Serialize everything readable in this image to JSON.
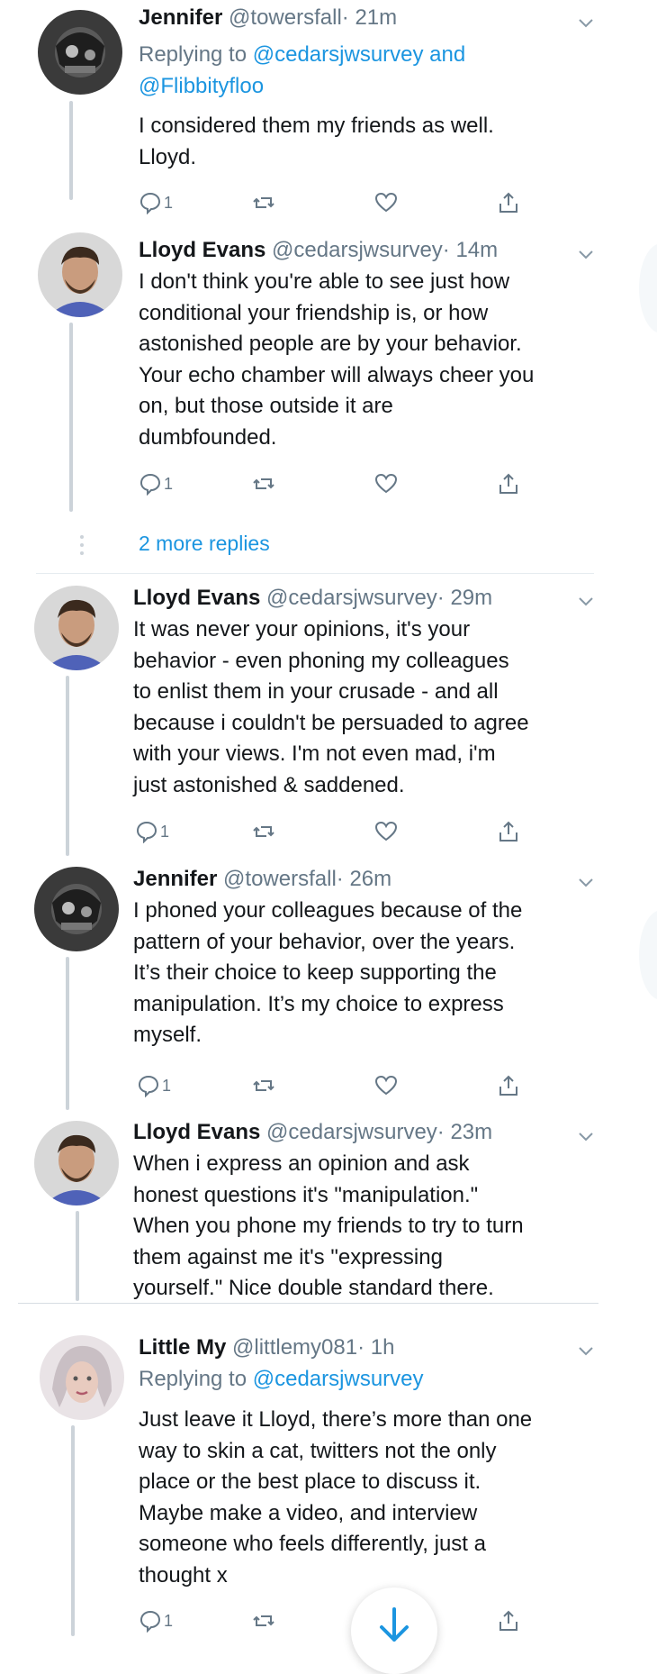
{
  "tweets": [
    {
      "name": "Jennifer",
      "handle": "@towersfall",
      "time": "· 21m",
      "replying_prefix": "Replying to",
      "replying_mention1": "@cedarsjwsurvey",
      "replying_and": "and",
      "replying_mention2": "@Flibbityfloo",
      "lines": [
        "I considered them my friends as well.",
        "Lloyd."
      ],
      "reply_count": "1"
    },
    {
      "name": "Lloyd Evans",
      "handle": "@cedarsjwsurvey",
      "time": "· 14m",
      "lines": [
        "I don't think you're able to see just how",
        "conditional your friendship is, or how",
        "astonished people are by your behavior.",
        "Your echo chamber will always cheer you",
        "on, but those outside it are",
        "dumbfounded."
      ],
      "reply_count": "1"
    },
    {
      "name": "Lloyd Evans",
      "handle": "@cedarsjwsurvey",
      "time": "· 29m",
      "lines": [
        "It was never your opinions, it's your",
        "behavior - even phoning my colleagues",
        "to enlist them in your crusade - and all",
        "because i couldn't be persuaded to agree",
        "with your views. I'm not even mad, i'm",
        "just astonished & saddened."
      ],
      "reply_count": "1"
    },
    {
      "name": "Jennifer",
      "handle": "@towersfall",
      "time": "· 26m",
      "lines": [
        "I phoned your colleagues because of the",
        "pattern of your behavior, over the years.",
        "It’s their choice to keep supporting the",
        "manipulation. It’s my choice to express",
        "myself."
      ],
      "reply_count": "1"
    },
    {
      "name": "Lloyd Evans",
      "handle": "@cedarsjwsurvey",
      "time": "· 23m",
      "lines": [
        "When i express an opinion and ask",
        "honest questions it's \"manipulation.\"",
        "When you phone my friends to try to turn",
        "them against me it's \"expressing",
        "yourself.\" Nice double standard there."
      ]
    },
    {
      "name": "Little My",
      "handle": "@littlemy081",
      "time": "· 1h",
      "replying_prefix": "Replying to",
      "replying_mention1": "@cedarsjwsurvey",
      "lines": [
        "Just leave it Lloyd, there’s more than one",
        "way to skin a cat, twitters not the only",
        "place or the best place to discuss it.",
        "Maybe make a video, and interview",
        "someone who feels differently, just a",
        "thought x"
      ],
      "reply_count": "1"
    }
  ],
  "more_replies": "2 more replies",
  "colors": {
    "link": "#1b95e0",
    "muted": "#657786",
    "text": "#14171a",
    "line": "#ccd3d9"
  },
  "icons": [
    "reply-icon",
    "retweet-icon",
    "like-icon",
    "share-icon",
    "chevron-down-icon",
    "scroll-down-arrow-icon"
  ]
}
